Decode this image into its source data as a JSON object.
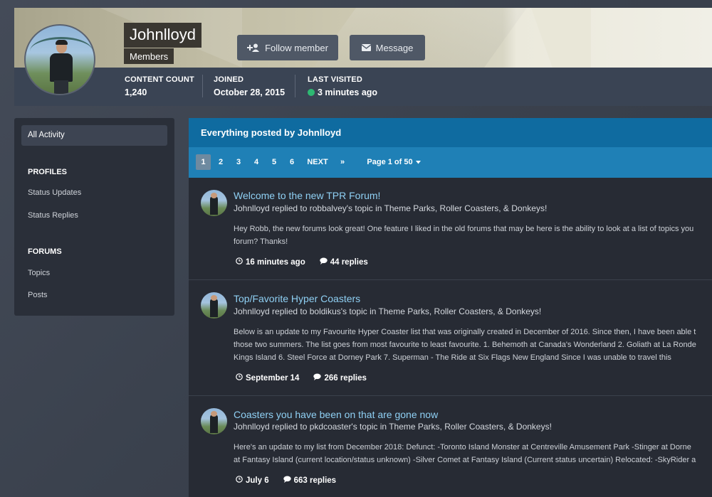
{
  "profile": {
    "name": "Johnlloyd",
    "group": "Members",
    "follow_label": "Follow member",
    "message_label": "Message",
    "stats": [
      {
        "label": "CONTENT COUNT",
        "value": "1,240"
      },
      {
        "label": "JOINED",
        "value": "October 28, 2015"
      },
      {
        "label": "LAST VISITED",
        "value": "3 minutes ago"
      }
    ],
    "online_color": "#2eb872"
  },
  "sidebar": {
    "active": "All Activity",
    "sections": [
      {
        "heading": "PROFILES",
        "items": [
          "Status Updates",
          "Status Replies"
        ]
      },
      {
        "heading": "FORUMS",
        "items": [
          "Topics",
          "Posts"
        ]
      }
    ]
  },
  "main": {
    "title": "Everything posted by Johnlloyd",
    "pagination": {
      "pages": [
        "1",
        "2",
        "3",
        "4",
        "5",
        "6"
      ],
      "current": "1",
      "next_label": "NEXT",
      "last_label": "»",
      "page_label": "Page 1 of 50"
    },
    "items": [
      {
        "title": "Welcome to the new TPR Forum!",
        "subtitle": "Johnlloyd replied to robbalvey's topic in Theme Parks, Roller Coasters, & Donkeys!",
        "body": [
          "Hey Robb, the new forums look great! One feature I liked in the old forums that may be here is the ability to look at a list of topics you",
          "forum? Thanks!"
        ],
        "time": "16 minutes ago",
        "replies": "44 replies"
      },
      {
        "title": "Top/Favorite Hyper Coasters",
        "subtitle": "Johnlloyd replied to boldikus's topic in Theme Parks, Roller Coasters, & Donkeys!",
        "body": [
          "Below is an update to my Favourite Hyper Coaster list that was originally created in December of 2016. Since then, I have been able t",
          "those two summers. The list goes from most favourite to least favourite. 1. Behemoth at Canada's Wonderland 2. Goliath at La Ronde",
          "Kings Island 6. Steel Force at Dorney Park 7. Superman - The Ride at Six Flags New England Since I was unable to travel this"
        ],
        "time": "September 14",
        "replies": "266 replies"
      },
      {
        "title": "Coasters you have been on that are gone now",
        "subtitle": "Johnlloyd replied to pkdcoaster's topic in Theme Parks, Roller Coasters, & Donkeys!",
        "body": [
          "Here's an update to my list from December 2018: Defunct: -Toronto Island Monster at Centreville Amusement Park -Stinger at Dorne",
          "at Fantasy Island (current location/status unknown) -Silver Comet at Fantasy Island (Current status uncertain) Relocated: -SkyRider a"
        ],
        "time": "July 6",
        "replies": "663 replies"
      }
    ]
  },
  "colors": {
    "header_blue": "#0f6ba0",
    "pager_blue": "#1f80b6",
    "link": "#8fd0f4"
  }
}
